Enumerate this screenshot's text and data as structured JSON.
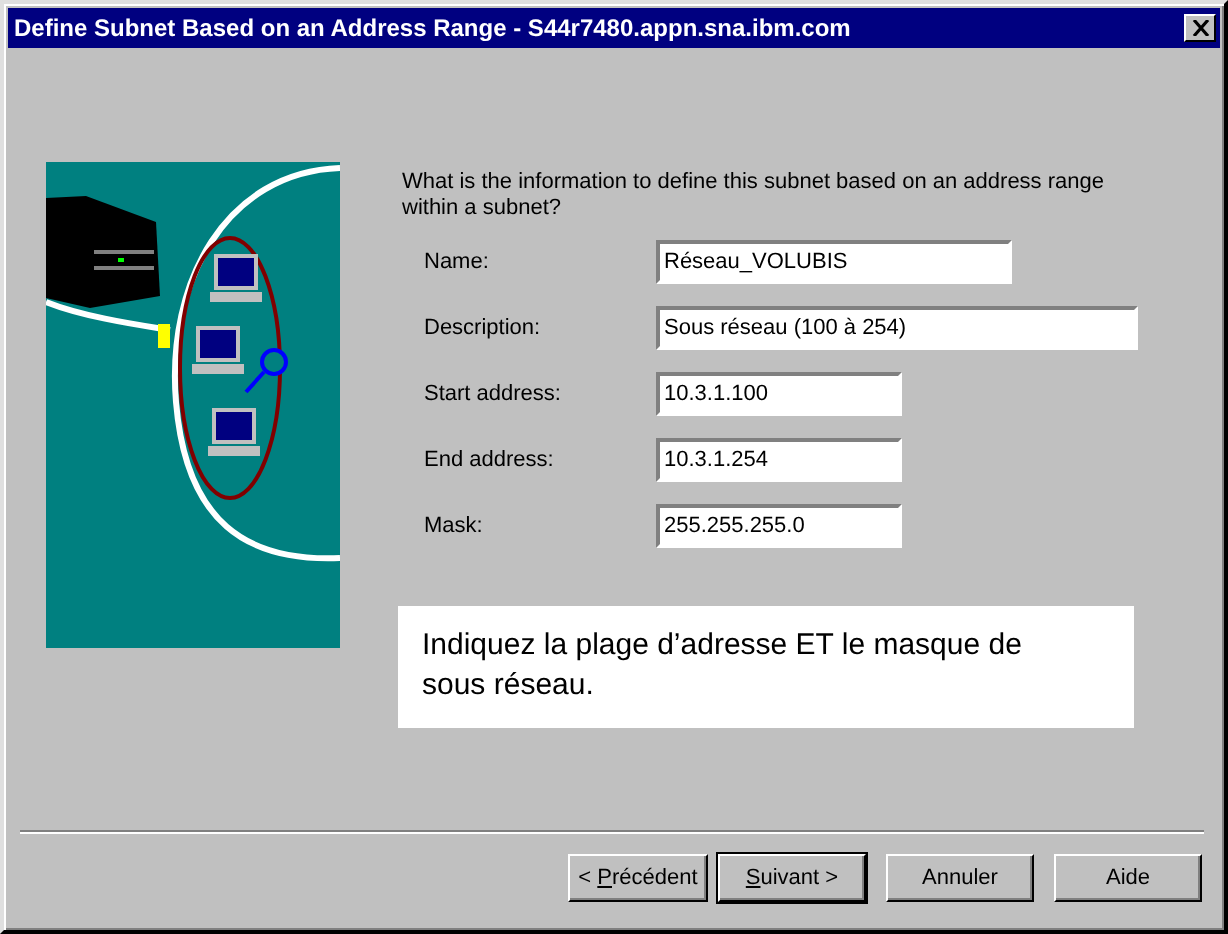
{
  "window": {
    "title": "Define Subnet Based on an Address Range - S44r7480.appn.sna.ibm.com"
  },
  "prompt": "What is the information to define this subnet based on an address range within a subnet?",
  "fields": [
    {
      "label": "Name:",
      "value": "Réseau_VOLUBIS"
    },
    {
      "label": "Description:",
      "value": "Sous réseau (100 à 254)"
    },
    {
      "label": "Start address:",
      "value": "10.3.1.100"
    },
    {
      "label": "End address:",
      "value": "10.3.1.254"
    },
    {
      "label": "Mask:",
      "value": "255.255.255.0"
    }
  ],
  "note": "Indiquez la plage d’adresse ET le masque de sous réseau.",
  "buttons": [
    {
      "prefix": "< ",
      "mnemonic": "P",
      "rest": "récédent",
      "default": false
    },
    {
      "mnemonic": "S",
      "rest": "uivant >",
      "default": true
    },
    {
      "rest": "Annuler",
      "default": false
    },
    {
      "rest": "Aide",
      "default": false
    }
  ]
}
